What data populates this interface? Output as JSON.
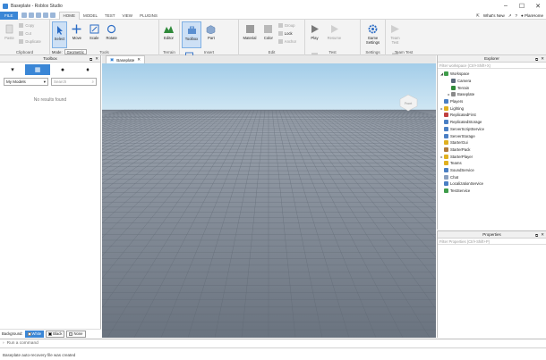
{
  "window": {
    "title": "Baseplate - Roblox Studio"
  },
  "menu": {
    "file": "FILE",
    "tabs": [
      "HOME",
      "MODEL",
      "TEST",
      "VIEW",
      "PLUGINS"
    ],
    "active_tab": "HOME",
    "whats_new": "What's New",
    "user": "PlanHome"
  },
  "ribbon": {
    "clipboard": {
      "label": "Clipboard",
      "paste": "Paste",
      "copy": "Copy",
      "cut": "Cut",
      "duplicate": "Duplicate"
    },
    "tools": {
      "label": "Tools",
      "select": "Select",
      "move": "Move",
      "scale": "Scale",
      "rotate": "Rotate",
      "mode_label": "Mode:",
      "mode_value": "Geometric",
      "collisions": "Collisions",
      "join_surfaces": "Join Surfaces"
    },
    "terrain": {
      "label": "Terrain",
      "editor": "Editor"
    },
    "insert": {
      "label": "Insert",
      "toolbox": "Toolbox",
      "part": "Part",
      "ui": "UI"
    },
    "edit": {
      "label": "Edit",
      "material": "Material",
      "color": "Color",
      "group": "Group",
      "lock": "Lock",
      "anchor": "Anchor"
    },
    "test": {
      "label": "Test",
      "play": "Play",
      "resume": "Resume",
      "stop": "Stop"
    },
    "settings": {
      "label": "Settings",
      "game_settings": "Game Settings"
    },
    "team_test": {
      "label": "Team Test",
      "team_test": "Team Test",
      "exit_game": "Exit Game"
    }
  },
  "toolbox": {
    "title": "Toolbox",
    "dropdown": "My Models",
    "search_placeholder": "Search",
    "empty": "No results found",
    "background_label": "Background:",
    "bg_options": [
      "White",
      "Black",
      "None"
    ],
    "bg_selected": "White"
  },
  "viewport": {
    "tab": "Baseplate",
    "gizmo_label": "Front"
  },
  "explorer": {
    "title": "Explorer",
    "filter_placeholder": "Filter workspace (Ctrl+Shift+X)",
    "items": [
      {
        "label": "Workspace",
        "depth": 0,
        "expanded": true,
        "icon": "workspace-icon",
        "color": "#3f9c4a"
      },
      {
        "label": "Camera",
        "depth": 1,
        "expanded": null,
        "icon": "camera-icon",
        "color": "#5a6a7a"
      },
      {
        "label": "Terrain",
        "depth": 1,
        "expanded": null,
        "icon": "terrain-icon",
        "color": "#2f8a3a"
      },
      {
        "label": "Baseplate",
        "depth": 1,
        "expanded": false,
        "icon": "part-icon",
        "color": "#8a8a8a"
      },
      {
        "label": "Players",
        "depth": 0,
        "expanded": null,
        "icon": "players-icon",
        "color": "#4a7fc4"
      },
      {
        "label": "Lighting",
        "depth": 0,
        "expanded": false,
        "icon": "lighting-icon",
        "color": "#e0b020"
      },
      {
        "label": "ReplicatedFirst",
        "depth": 0,
        "expanded": null,
        "icon": "replicated-first-icon",
        "color": "#c04040"
      },
      {
        "label": "ReplicatedStorage",
        "depth": 0,
        "expanded": null,
        "icon": "replicated-storage-icon",
        "color": "#4a7fc4"
      },
      {
        "label": "ServerScriptService",
        "depth": 0,
        "expanded": null,
        "icon": "server-script-icon",
        "color": "#4a7fc4"
      },
      {
        "label": "ServerStorage",
        "depth": 0,
        "expanded": null,
        "icon": "server-storage-icon",
        "color": "#4a7fc4"
      },
      {
        "label": "StarterGui",
        "depth": 0,
        "expanded": null,
        "icon": "starter-gui-icon",
        "color": "#e0b020"
      },
      {
        "label": "StarterPack",
        "depth": 0,
        "expanded": null,
        "icon": "starter-pack-icon",
        "color": "#b07a3a"
      },
      {
        "label": "StarterPlayer",
        "depth": 0,
        "expanded": false,
        "icon": "starter-player-icon",
        "color": "#e0b020"
      },
      {
        "label": "Teams",
        "depth": 0,
        "expanded": null,
        "icon": "teams-icon",
        "color": "#e0b020"
      },
      {
        "label": "SoundService",
        "depth": 0,
        "expanded": null,
        "icon": "sound-icon",
        "color": "#4a7fc4"
      },
      {
        "label": "Chat",
        "depth": 0,
        "expanded": null,
        "icon": "chat-icon",
        "color": "#8aa0c0"
      },
      {
        "label": "LocalizationService",
        "depth": 0,
        "expanded": null,
        "icon": "localization-icon",
        "color": "#4a7fc4"
      },
      {
        "label": "TestService",
        "depth": 0,
        "expanded": null,
        "icon": "test-service-icon",
        "color": "#3f9c4a"
      }
    ]
  },
  "properties": {
    "title": "Properties",
    "filter_placeholder": "Filter Properties (Ctrl+Shift+P)"
  },
  "command": {
    "placeholder": "Run a command"
  },
  "status": {
    "text": "Baseplate auto-recovery file was created"
  }
}
